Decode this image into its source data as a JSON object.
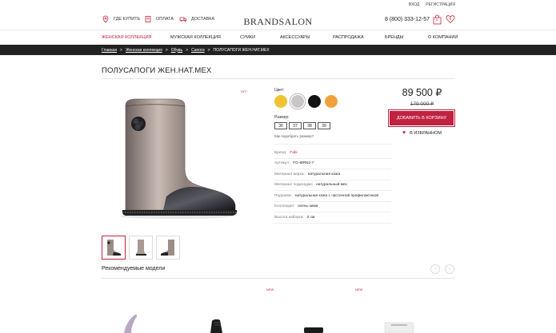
{
  "top_links": {
    "login": "ВХОД",
    "register": "РЕГИСТРАЦИЯ"
  },
  "header": {
    "where_to_buy": "ГДЕ КУПИТЬ",
    "payment": "ОПЛАТА",
    "delivery": "ДОСТАВКА",
    "logo": "BRANDSALON",
    "phone": "8 (800) 333-12-57",
    "cart_count": "1",
    "wishlist_count": "0"
  },
  "nav": {
    "items": [
      "ЖЕНСКАЯ КОЛЛЕКЦИЯ",
      "МУЖСКАЯ КОЛЛЕКЦИЯ",
      "СУМКИ",
      "АКСЕССУАРЫ",
      "РАСПРОДАЖА",
      "БРЕНДЫ",
      "О КОМПАНИИ"
    ],
    "active_index": 0
  },
  "breadcrumb": {
    "items": [
      "Главная",
      "Женская коллекция",
      "Обувь",
      "Сапоги",
      "ПОЛУСАПОГИ ЖЕН.НАТ.МЕХ"
    ],
    "separator": ">"
  },
  "product": {
    "title": "ПОЛУСАПОГИ ЖЕН.НАТ.МЕХ",
    "tag": "HIT!",
    "color_label": "Цвет:",
    "colors": [
      "#f2c233",
      "#c8c6c6",
      "#111111",
      "#f1a13c"
    ],
    "selected_color_index": 1,
    "size_label": "Размер:",
    "sizes": [
      "36",
      "37",
      "38",
      "39"
    ],
    "size_help": "Как подобрать размер?",
    "specs": [
      {
        "key": "Бренд:",
        "value": "Fabi",
        "highlight": true
      },
      {
        "key": "Артикул:",
        "value": "FG-MRN2-7"
      },
      {
        "key": "Материал верха:",
        "value": "натуральная кожа"
      },
      {
        "key": "Материал подкладки:",
        "value": "натуральный мех"
      },
      {
        "key": "Подошва:",
        "value": "натуральная кожа с частичной профилактикой"
      },
      {
        "key": "Коллекция:",
        "value": "осень-зима"
      },
      {
        "key": "Высота каблука:",
        "value": "2 см"
      }
    ],
    "price": "89 500 ₽",
    "old_price": "179 000 ₽",
    "buy_label": "ДОБАВИТЬ В КОРЗИНУ",
    "favorite_label": "В ИЗБРАННОМ",
    "accent_color": "#c0223f"
  },
  "recommended": {
    "title": "Рекомендуемые модели",
    "new_tag": "NEW",
    "prev_icon": "arrow-left-icon",
    "next_icon": "arrow-right-icon"
  }
}
